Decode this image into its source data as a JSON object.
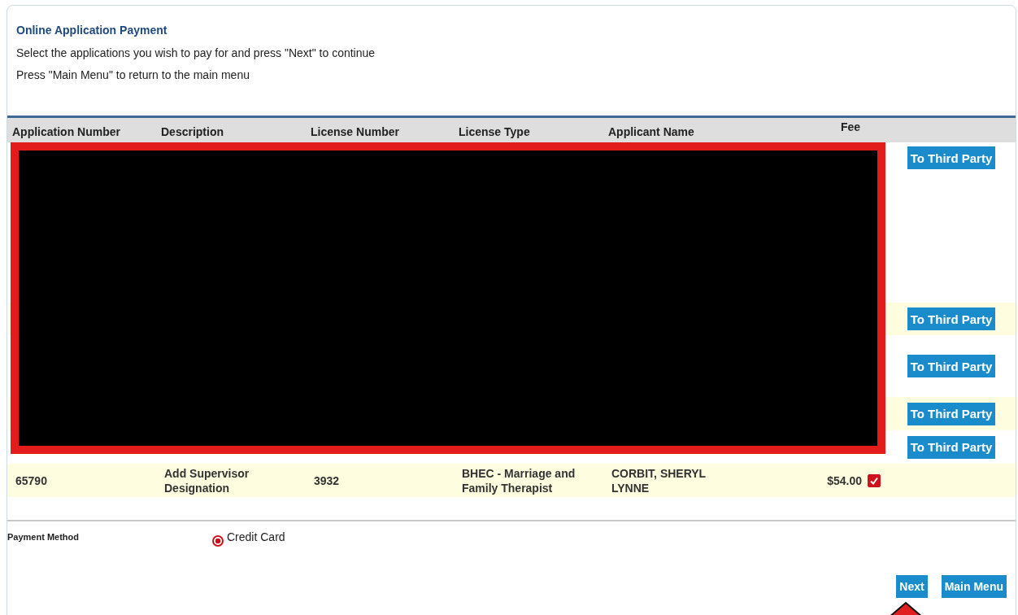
{
  "page": {
    "title": "Online Application Payment",
    "instructions": [
      "Select the applications you wish to pay for and press \"Next\" to continue",
      "Press \"Main Menu\" to return to the main menu"
    ]
  },
  "table": {
    "columns": [
      "Application Number",
      "Description",
      "License Number",
      "License Type",
      "Applicant Name",
      "Fee"
    ],
    "rows": [
      {
        "kind": "redacted",
        "button": "To Third Party"
      },
      {
        "kind": "redacted",
        "button": "To Third Party"
      },
      {
        "kind": "redacted",
        "button": "To Third Party"
      },
      {
        "kind": "redacted",
        "button": "To Third Party"
      },
      {
        "kind": "redacted",
        "button": "To Third Party"
      },
      {
        "kind": "application",
        "application_number": "65790",
        "description": "Add Supervisor Designation",
        "license_number": "3932",
        "license_type": "BHEC - Marriage and Family Therapist",
        "applicant_name": "CORBIT, SHERYL LYNNE",
        "fee": "$54.00",
        "checked": true
      }
    ]
  },
  "payment": {
    "label": "Payment Method",
    "options": [
      {
        "label": "Credit Card",
        "selected": true
      }
    ]
  },
  "buttons": [
    "Next",
    "Main Menu"
  ]
}
